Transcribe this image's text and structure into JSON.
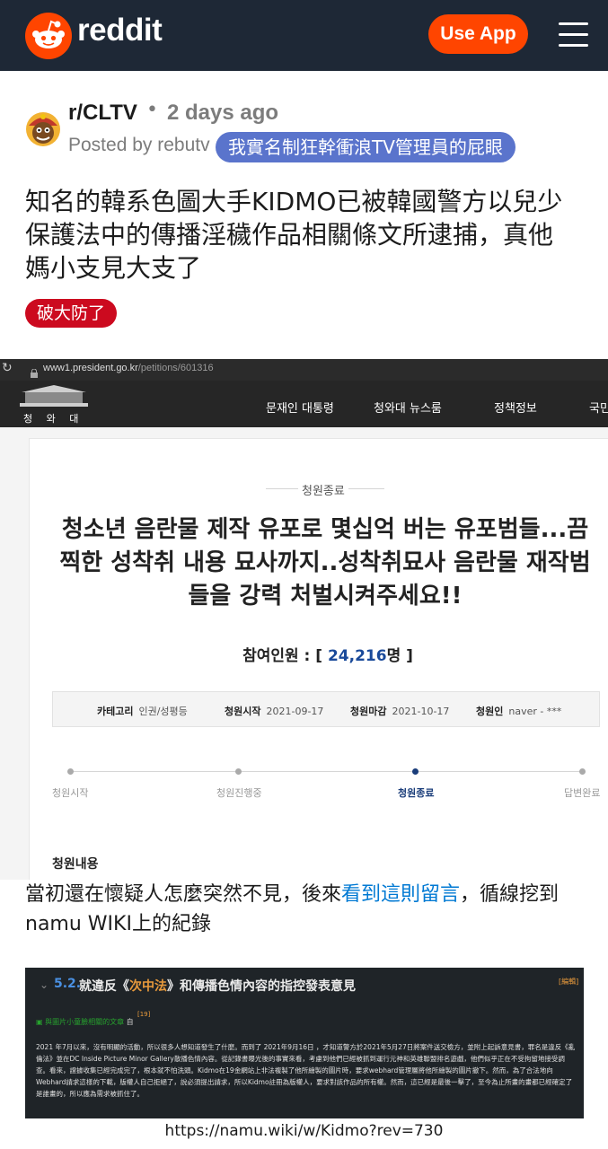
{
  "header": {
    "brand": "reddit",
    "use_app_label": "Use App"
  },
  "post": {
    "subreddit": "r/CLTV",
    "separator": "•",
    "age": "2 days ago",
    "posted_by": "Posted by rebutv",
    "user_flair": "我實名制狂幹衝浪TV管理員的屁眼",
    "title": "知名的韓系色圖大手KIDMO已被韓國警方以兒少保護法中的傳播淫穢作品相關條文所逮捕，真他媽小支見大支了",
    "post_flair": "破大防了",
    "body_text_before_link": "當初還在懷疑人怎麼突然不見，後來",
    "body_link": "看到這則留言",
    "body_text_after_link": "，循線挖到namu WIKI上的紀錄",
    "source_url": "https://namu.wiki/w/Kidmo?rev=730"
  },
  "petition_screenshot": {
    "browser_url_host": "www1.president.go.kr",
    "browser_url_path": "/petitions/601316",
    "site_name": "청 와 대",
    "nav": [
      "문재인 대통령",
      "청와대 뉴스룸",
      "정책정보",
      "국민"
    ],
    "status": "청원종료",
    "title": "청소년 음란물 제작 유포로 몇십억 버는 유포범들...끔찍한 성착취 내용 묘사까지..성착취묘사 음란물 재작범들을 강력 처벌시켜주세요!!",
    "participants_label": "참여인원 : [ ",
    "participants_count": "24,216",
    "participants_unit": "명 ]",
    "info": [
      {
        "label": "카테고리",
        "value": "인권/성평등"
      },
      {
        "label": "청원시작",
        "value": "2021-09-17"
      },
      {
        "label": "청원마감",
        "value": "2021-10-17"
      },
      {
        "label": "청원인",
        "value": "naver - ***"
      }
    ],
    "progress_steps": [
      "청원시작",
      "청원진행중",
      "청원종료",
      "답변완료"
    ],
    "progress_active_index": 2,
    "content_label": "청원내용"
  },
  "wiki_screenshot": {
    "section_number": "5.2.",
    "heading_before": "就違反《",
    "heading_highlight": "次中法",
    "heading_after": "》和傳播色情內容的指控發表意見",
    "edit_label": "[編輯]",
    "footnote": "[19]",
    "badge_text": "與圖片小童臉相關的文章",
    "badge_suffix": "自",
    "paragraph": "2021 年7月以來，沒有明顯的活動，所以很多人想知道發生了什麼。而到了 2021年9月16日 ，才知道警方於2021年5月27日將案件送交檢方，並附上起訴意見書，罪名是違反《亂倫法》並在DC Inside Picture Minor Gallery散播色情內容。從記錄書曝光後的事實來看，考慮到他們已經被抓到運行元神和英雄聯盟排名遊戲，他們似乎正在不受拘留地接受調查。看來，證據收集已經完成完了，根本就不怕洗頭。Kidmo在19金網站上非法複製了他所繪製的圖片時，要求webhard管理層將他所繪製的圖片撤下。然而，為了合法地向Webhard請求這樣的下載，版權人自己拒絕了，說必須提出請求，所以Kidmo註冊為版權人，要求對該作品的所有權。然而，這已經是最後一擊了，至今為止所畫的畫都已經確定了是誰畫的，所以應為需求被抓住了。"
  },
  "colors": {
    "header_bg": "#1e2836",
    "reddit_orange": "#ff4500",
    "user_flair_bg": "#5a74cc",
    "post_flair_bg": "#cc0a1f",
    "link_blue": "#0079d3"
  }
}
